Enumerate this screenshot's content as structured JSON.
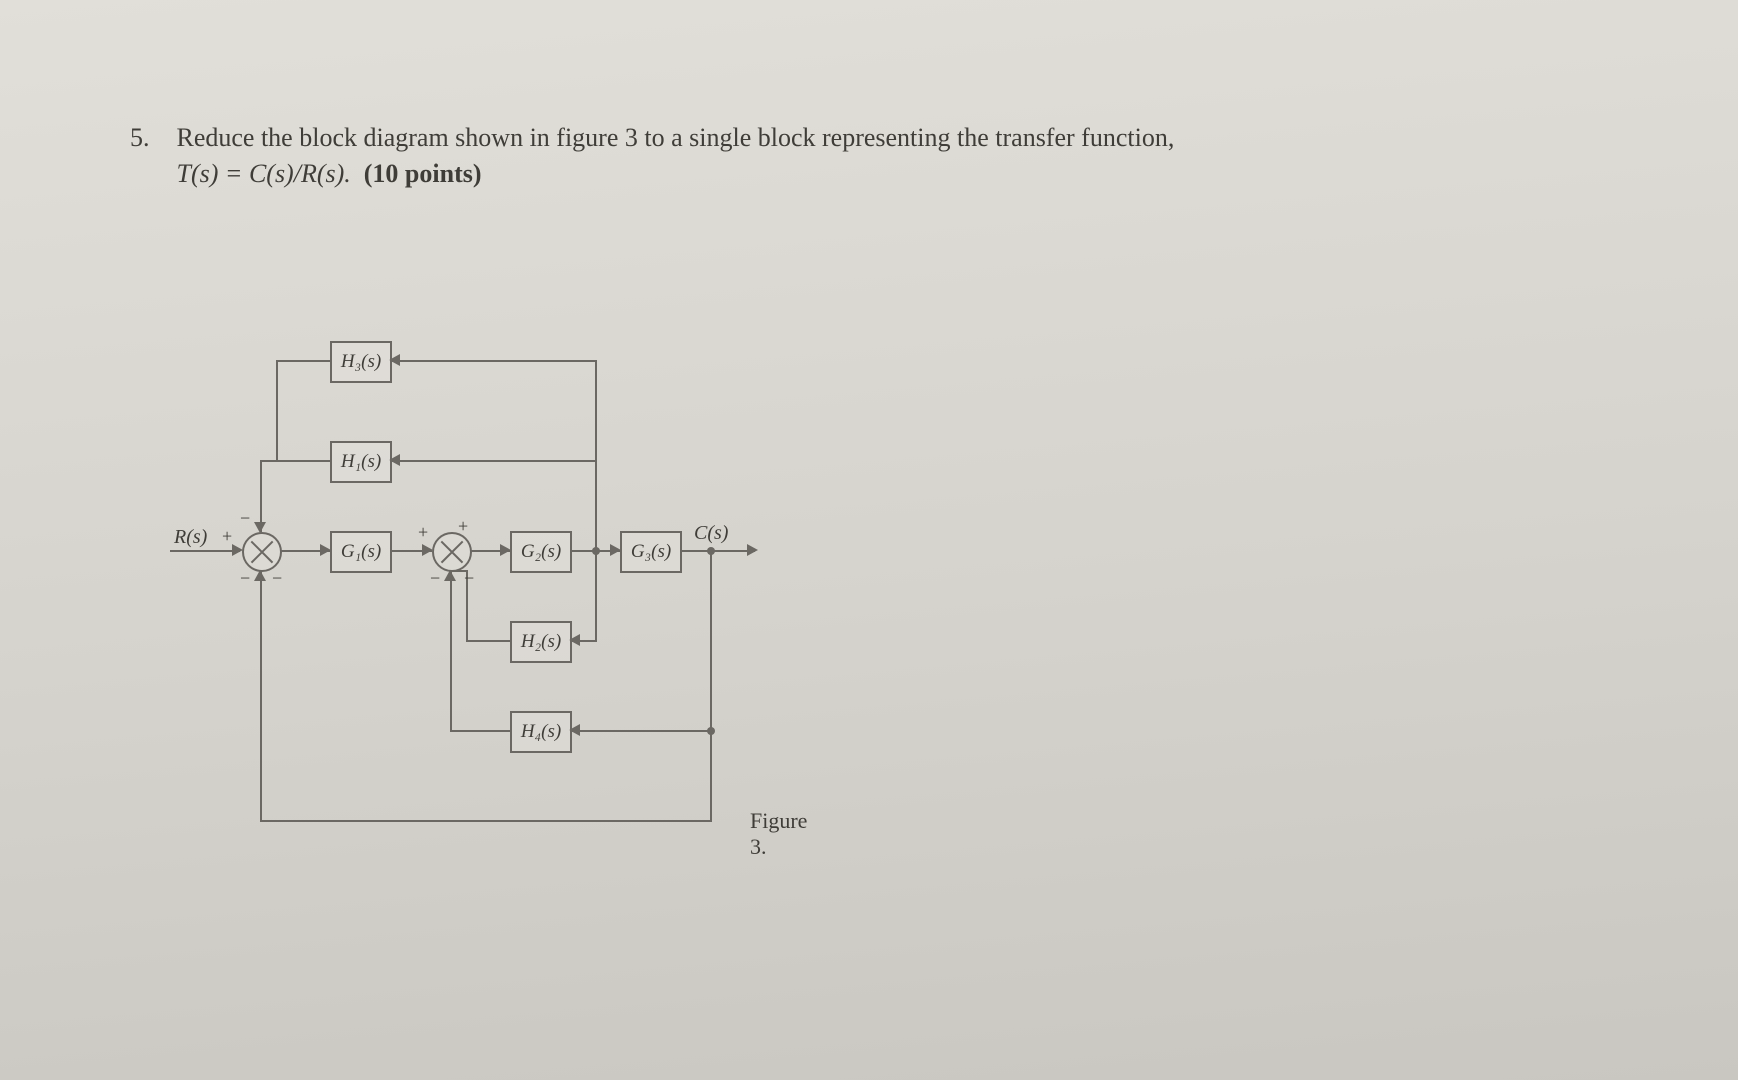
{
  "problem": {
    "number": "5.",
    "line1_a": "Reduce the block diagram shown in figure 3 to a single block representing the transfer function,",
    "line2_tf": "T(s) = C(s)/R(s).",
    "line2_pts": "(10 points)"
  },
  "diagram": {
    "input_label": "R(s)",
    "output_label": "C(s)",
    "blocks": {
      "H3": "H₃(s)",
      "H1": "H₁(s)",
      "G1": "G₁(s)",
      "G2": "G₂(s)",
      "G3": "G₃(s)",
      "H2": "H₂(s)",
      "H4": "H₄(s)"
    },
    "signs": {
      "sum1_top": "−",
      "sum1_input_plus": "+",
      "sum1_bottom1": "−",
      "sum1_bottom2": "−",
      "sum2_top": "+",
      "sum2_input_plus": "+",
      "sum2_bottom1": "−",
      "sum2_bottom2": "−"
    },
    "figure_caption": "Figure 3."
  }
}
